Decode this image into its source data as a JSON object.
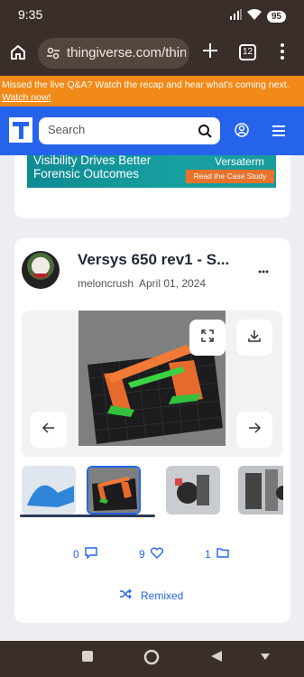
{
  "status_bar": {
    "time": "9:35",
    "battery": "95"
  },
  "browser": {
    "url": "thingiverse.com/thing",
    "tab_count": "12"
  },
  "banner": {
    "text": "Missed the live Q&A? Watch the recap and hear what's coming next. ",
    "link": "Watch now!"
  },
  "header": {
    "search_placeholder": "Search"
  },
  "ad": {
    "line1": "Visibility Drives Better",
    "line2": "Forensic Outcomes",
    "brand": "Versaterm",
    "cta": "Read the Case Study"
  },
  "thing": {
    "title": "Versys 650 rev1 - S...",
    "author": "meloncrush",
    "date": "April 01, 2024"
  },
  "stats": {
    "comments": "0",
    "likes": "9",
    "collections": "1",
    "remixed_label": "Remixed"
  },
  "colors": {
    "accent": "#2563eb",
    "banner": "#f28a19",
    "chrome": "#3a2e2a"
  }
}
